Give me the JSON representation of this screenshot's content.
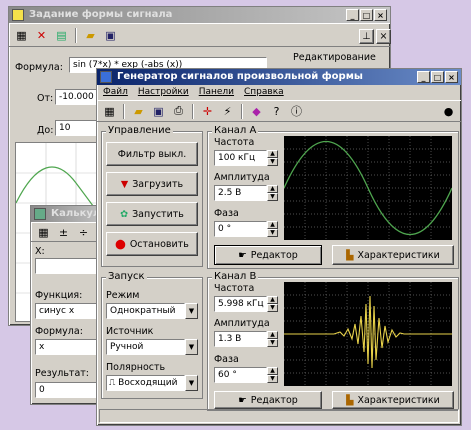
{
  "back_window": {
    "title": "Задание формы сигнала",
    "formula_label": "Формула:",
    "formula_value": "sin (7*x) * exp (-abs (x))",
    "edit_label": "Редактирование",
    "from_label": "От:",
    "from_value": "-10.000",
    "to_label": "До:",
    "to_value": "10"
  },
  "calc_window": {
    "title": "Калькулятор",
    "x_label": "X:",
    "x_value": "",
    "function_label": "Функция:",
    "function_value": "синус x",
    "formula_label": "Формула:",
    "formula_value": "x",
    "result_label": "Результат:",
    "result_value": "0"
  },
  "main_window": {
    "title": "Генератор сигналов произвольной формы",
    "menu": [
      "Файл",
      "Настройки",
      "Панели",
      "Справка"
    ],
    "control": {
      "group_label": "Управление",
      "filter_button": "Фильтр выкл.",
      "load_button": "Загрузить",
      "start_button": "Запустить",
      "stop_button": "Остановить"
    },
    "launch": {
      "group_label": "Запуск",
      "mode_label": "Режим",
      "mode_value": "Однократный",
      "source_label": "Источник",
      "source_value": "Ручной",
      "polarity_label": "Полярность",
      "polarity_value": "Восходящий"
    },
    "channel_a": {
      "group_label": "Канал А",
      "freq_label": "Частота",
      "freq_value": "100 кГц",
      "amp_label": "Амплитуда",
      "amp_value": "2.5 В",
      "phase_label": "Фаза",
      "phase_value": "0 °",
      "editor_button": "Редактор",
      "chars_button": "Характеристики"
    },
    "channel_b": {
      "group_label": "Канал В",
      "freq_label": "Частота",
      "freq_value": "5.998 кГц",
      "amp_label": "Амплитуда",
      "amp_value": "1.3 В",
      "phase_label": "Фаза",
      "phase_value": "60 °",
      "editor_button": "Редактор",
      "chars_button": "Характеристики"
    }
  },
  "colors": {
    "sine_trace": "#4fa64f",
    "burst_trace": "#e8d24a",
    "scope_bg": "#000000",
    "grid": "#6a6a6a",
    "title_active": "#0a246a"
  }
}
